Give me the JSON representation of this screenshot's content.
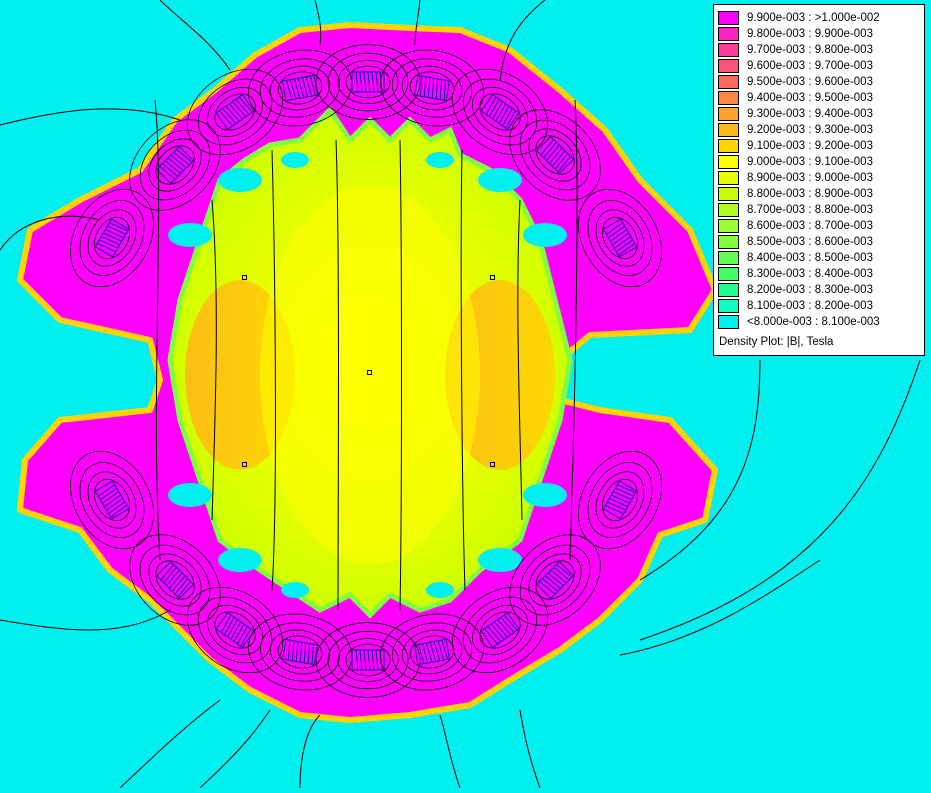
{
  "plot": {
    "background_color": "#00f0f0",
    "high_color": "#ff00ff",
    "low_color": "#00f0f0",
    "contour_color": "#000000",
    "coil_color": "#1a1aa0"
  },
  "legend": {
    "title": "Density Plot: |B|, Tesla",
    "items": [
      {
        "label": "9.900e-003 : >1.000e-002",
        "color": "#ff00ff"
      },
      {
        "label": "9.800e-003 : 9.900e-003",
        "color": "#ff20c8"
      },
      {
        "label": "9.700e-003 : 9.800e-003",
        "color": "#ff3c9a"
      },
      {
        "label": "9.600e-003 : 9.700e-003",
        "color": "#ff5478"
      },
      {
        "label": "9.500e-003 : 9.600e-003",
        "color": "#ff6a5a"
      },
      {
        "label": "9.400e-003 : 9.500e-003",
        "color": "#ff8840"
      },
      {
        "label": "9.300e-003 : 9.400e-003",
        "color": "#ffa028"
      },
      {
        "label": "9.200e-003 : 9.300e-003",
        "color": "#ffb818"
      },
      {
        "label": "9.100e-003 : 9.200e-003",
        "color": "#ffd400"
      },
      {
        "label": "9.000e-003 : 9.100e-003",
        "color": "#ffff00"
      },
      {
        "label": "8.900e-003 : 9.000e-003",
        "color": "#e8ff00"
      },
      {
        "label": "8.800e-003 : 8.900e-003",
        "color": "#c8ff00"
      },
      {
        "label": "8.700e-003 : 8.800e-003",
        "color": "#b0ff20"
      },
      {
        "label": "8.600e-003 : 8.700e-003",
        "color": "#98ff30"
      },
      {
        "label": "8.500e-003 : 8.600e-003",
        "color": "#80ff40"
      },
      {
        "label": "8.400e-003 : 8.500e-003",
        "color": "#60ff50"
      },
      {
        "label": "8.300e-003 : 8.400e-003",
        "color": "#40ff60"
      },
      {
        "label": "8.200e-003 : 8.300e-003",
        "color": "#20ff90"
      },
      {
        "label": "8.100e-003 : 8.200e-003",
        "color": "#10ffc0"
      },
      {
        "label": "<8.000e-003 : 8.100e-003",
        "color": "#00f0f0"
      }
    ]
  }
}
